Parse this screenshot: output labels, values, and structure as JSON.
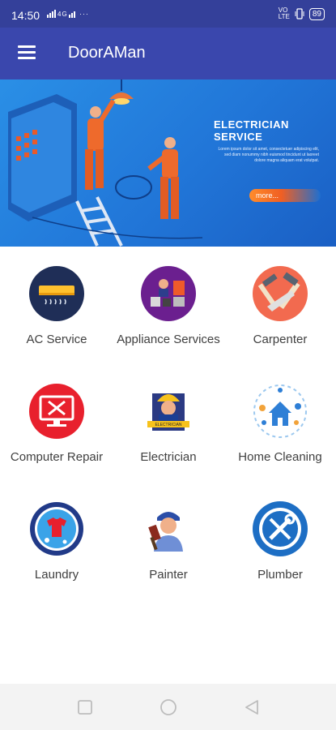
{
  "status_bar": {
    "time": "14:50",
    "left_indicators": "•••• ••• ⋯",
    "battery": "89"
  },
  "app_bar": {
    "title": "DoorAMan"
  },
  "banner": {
    "title": "ELECTRICIAN SERVICE",
    "text": "Lorem ipsum dolor sit amet, consectetuer adipiscing elit, sed diam nonummy nibh euismod tincidunt ut laoreet dolore magna aliquam erat volutpat.",
    "more_label": "more..."
  },
  "services": [
    {
      "label": "AC Service",
      "icon": "ac-icon"
    },
    {
      "label": "Appliance Services",
      "icon": "appliance-icon"
    },
    {
      "label": "Carpenter",
      "icon": "carpenter-icon"
    },
    {
      "label": "Computer Repair",
      "icon": "computer-repair-icon"
    },
    {
      "label": "Electrician",
      "icon": "electrician-icon"
    },
    {
      "label": "Home Cleaning",
      "icon": "home-cleaning-icon"
    },
    {
      "label": "Laundry",
      "icon": "laundry-icon"
    },
    {
      "label": "Painter",
      "icon": "painter-icon"
    },
    {
      "label": "Plumber",
      "icon": "plumber-icon"
    }
  ],
  "colors": {
    "app_bar": "#3a47ad",
    "status_bar": "#34409a",
    "banner": "#2176d8",
    "accent_orange": "#f05f23"
  }
}
